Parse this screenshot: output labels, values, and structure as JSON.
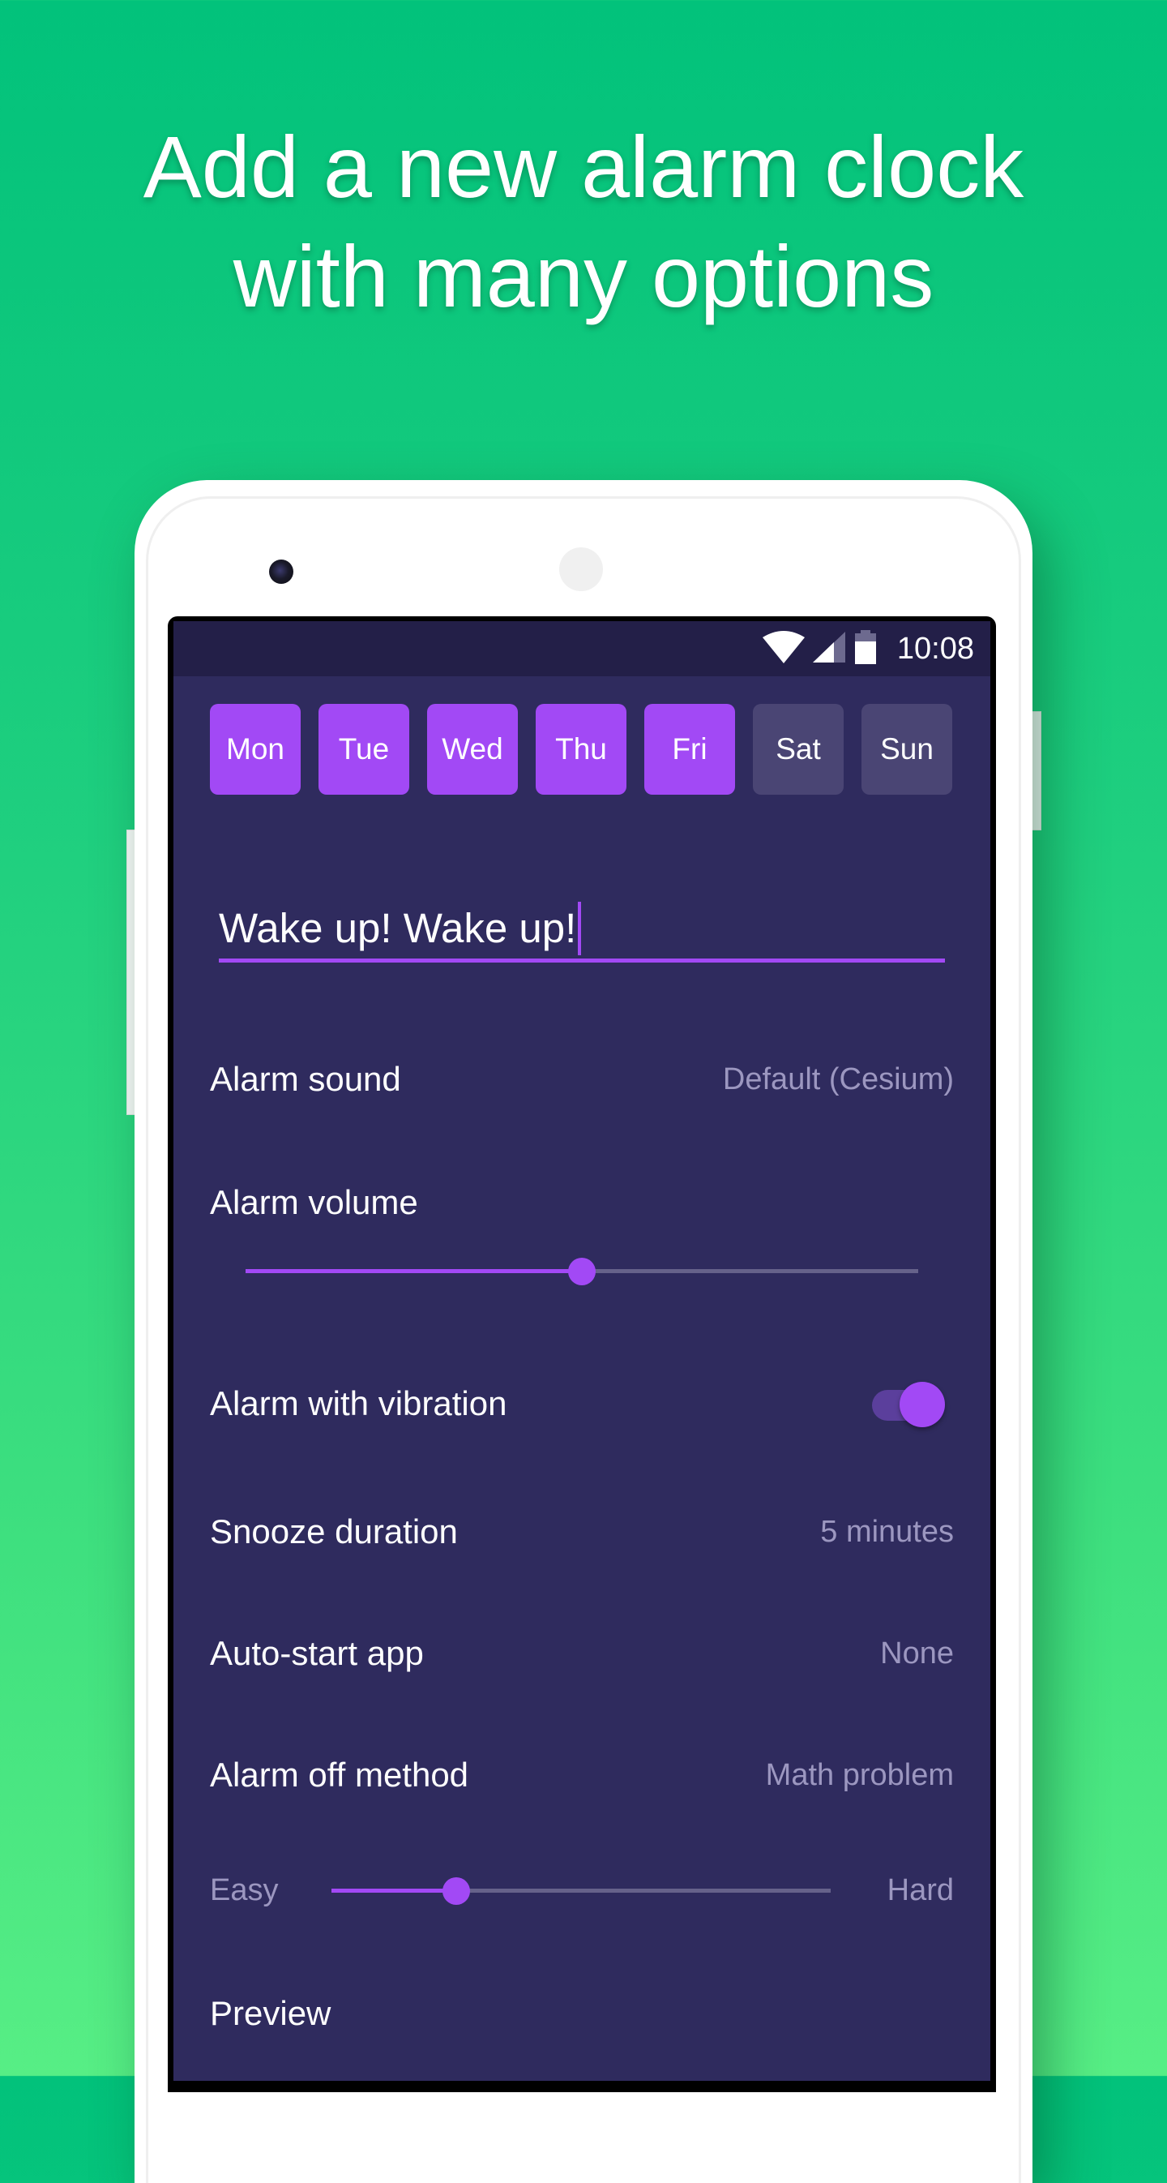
{
  "headline": {
    "line1": "Add a new alarm clock",
    "line2": "with many options"
  },
  "status_bar": {
    "time": "10:08",
    "icons": [
      "wifi-icon",
      "cellular-signal-icon",
      "battery-icon"
    ]
  },
  "days": [
    {
      "label": "Mon",
      "selected": true
    },
    {
      "label": "Tue",
      "selected": true
    },
    {
      "label": "Wed",
      "selected": true
    },
    {
      "label": "Thu",
      "selected": true
    },
    {
      "label": "Fri",
      "selected": true
    },
    {
      "label": "Sat",
      "selected": false
    },
    {
      "label": "Sun",
      "selected": false
    }
  ],
  "alarm_name": {
    "value": "Wake up! Wake up!"
  },
  "settings": {
    "alarm_sound": {
      "label": "Alarm sound",
      "value": "Default (Cesium)"
    },
    "alarm_volume": {
      "label": "Alarm volume",
      "level_percent": 50
    },
    "vibration": {
      "label": "Alarm with vibration",
      "enabled": true
    },
    "snooze": {
      "label": "Snooze duration",
      "value": "5 minutes"
    },
    "auto_start": {
      "label": "Auto-start app",
      "value": "None"
    },
    "off_method": {
      "label": "Alarm off method",
      "value": "Math problem"
    },
    "difficulty": {
      "min_label": "Easy",
      "max_label": "Hard",
      "level_percent": 25
    },
    "preview": {
      "label": "Preview"
    }
  },
  "colors": {
    "accent": "#a249f5",
    "screen_bg": "#2f2b5e",
    "status_bar_bg": "#231f48",
    "day_off_bg": "#4a4574",
    "secondary_text": "#9c97c0",
    "background_top": "#02c27b",
    "background_bottom": "#57ee85"
  }
}
